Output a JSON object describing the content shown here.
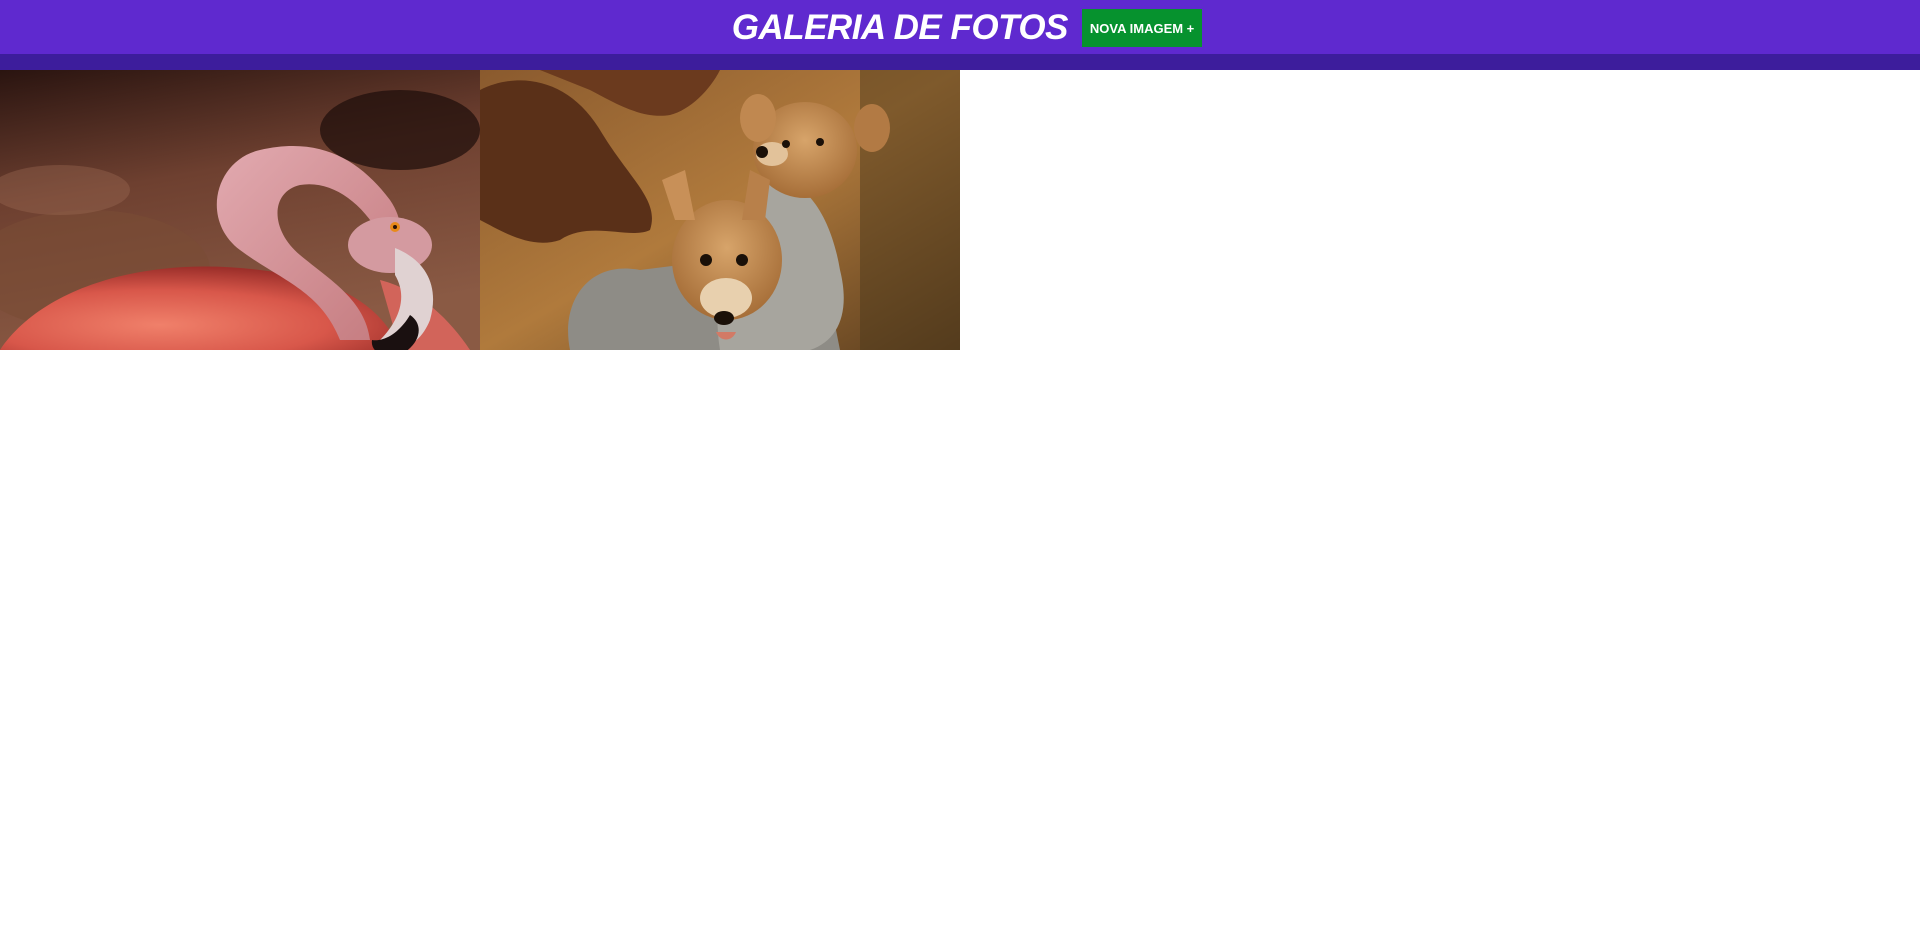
{
  "header": {
    "title": "GALERIA DE FOTOS",
    "add_button_label": "NOVA IMAGEM +"
  },
  "colors": {
    "header_bg": "#5f29cf",
    "header_border": "#3d1d9c",
    "button_bg": "#06922e",
    "button_text": "#ffffff"
  },
  "gallery": {
    "photos": [
      {
        "subject": "flamingo"
      },
      {
        "subject": "puppies in a sack"
      }
    ]
  }
}
